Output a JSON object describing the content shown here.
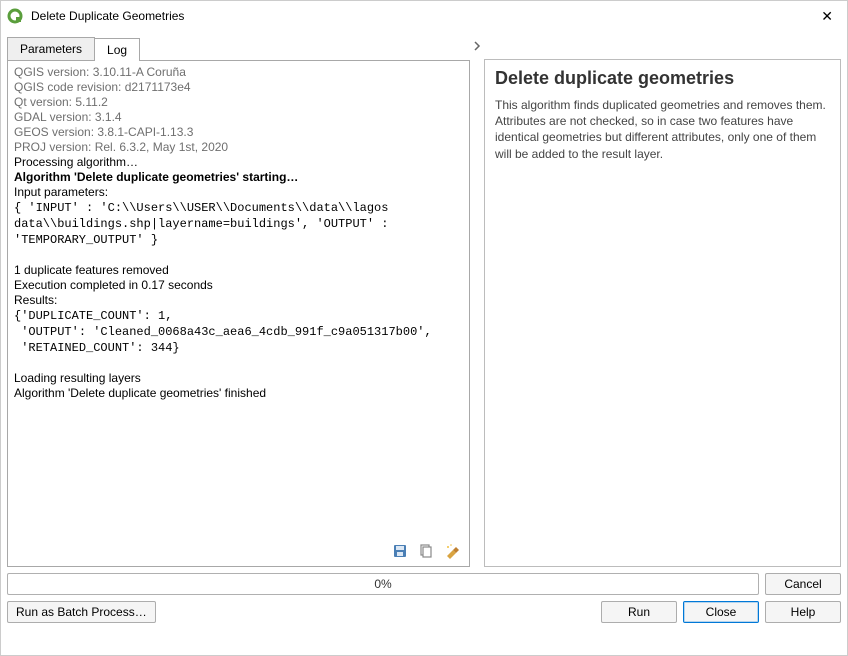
{
  "window": {
    "title": "Delete Duplicate Geometries",
    "close": "✕"
  },
  "tabs": {
    "parameters": "Parameters",
    "log": "Log"
  },
  "log": {
    "v_qgis": "QGIS version: 3.10.11-A Coruña",
    "v_rev": "QGIS code revision: d2171173e4",
    "v_qt": "Qt version: 5.11.2",
    "v_gdal": "GDAL version: 3.1.4",
    "v_geos": "GEOS version: 3.8.1-CAPI-1.13.3",
    "v_proj": "PROJ version: Rel. 6.3.2, May 1st, 2020",
    "processing": "Processing algorithm…",
    "starting": "Algorithm 'Delete duplicate geometries' starting…",
    "input_hdr": "Input parameters:",
    "input_val": "{ 'INPUT' : 'C:\\\\Users\\\\USER\\\\Documents\\\\data\\\\lagos data\\\\buildings.shp|layername=buildings', 'OUTPUT' : 'TEMPORARY_OUTPUT' }",
    "dup_removed": "1 duplicate features removed",
    "exec_done": "Execution completed in 0.17 seconds",
    "results_hdr": "Results:",
    "results_val": "{'DUPLICATE_COUNT': 1,\n 'OUTPUT': 'Cleaned_0068a43c_aea6_4cdb_991f_c9a051317b00',\n 'RETAINED_COUNT': 344}",
    "loading": "Loading resulting layers",
    "finished": "Algorithm 'Delete duplicate geometries' finished"
  },
  "help": {
    "title": "Delete duplicate geometries",
    "body": "This algorithm finds duplicated geometries and removes them. Attributes are not checked, so in case two features have identical geometries but different attributes, only one of them will be added to the result layer."
  },
  "progress": {
    "label": "0%"
  },
  "buttons": {
    "cancel": "Cancel",
    "batch": "Run as Batch Process…",
    "run": "Run",
    "close": "Close",
    "help": "Help"
  },
  "icons": {
    "save_title": "Save log",
    "copy_title": "Copy log",
    "clear_title": "Clear log"
  }
}
